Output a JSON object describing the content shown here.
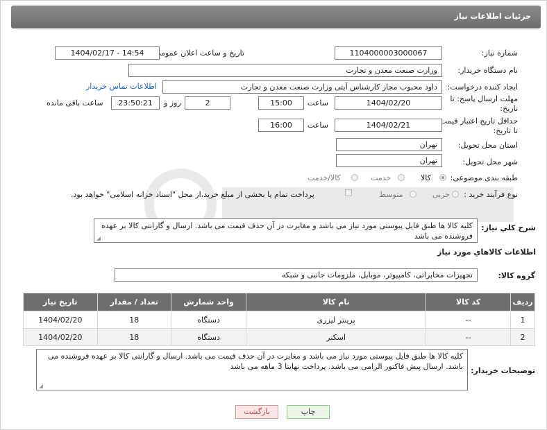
{
  "header": {
    "title": "جزئیات اطلاعات نیاز"
  },
  "form": {
    "need_number": {
      "label": "شماره نیاز:",
      "value": "1104000003000067"
    },
    "announce_datetime": {
      "label": "تاریخ و ساعت اعلان عمومی:",
      "value": "1404/02/17 - 14:54"
    },
    "buyer_org": {
      "label": "نام دستگاه خریدار:",
      "value": "وزارت صنعت معدن و تجارت"
    },
    "requester": {
      "label": "ایجاد کننده درخواست:",
      "value": "داود محبوب مجاز کارشناس آیتی وزارت صنعت معدن و تجارت",
      "contact_link": "اطلاعات تماس خریدار"
    },
    "reply_deadline": {
      "label_line1": "مهلت ارسال پاسخ: تا",
      "label_line2": "تاریخ:",
      "date": "1404/02/20",
      "time_label": "ساعت",
      "time": "15:00",
      "days": "2",
      "days_label": "روز و",
      "remaining": "23:50:21",
      "remaining_label": "ساعت باقی مانده"
    },
    "price_validity": {
      "label_line1": "حداقل تاریخ اعتبار قیمت:",
      "label_line2": "تا تاریخ:",
      "date": "1404/02/21",
      "time_label": "ساعت",
      "time": "16:00"
    },
    "delivery_province": {
      "label": "استان محل تحویل:",
      "value": "تهران"
    },
    "delivery_city": {
      "label": "شهر محل تحویل:",
      "value": "تهران"
    },
    "category": {
      "label": "طبقه بندی موضوعی:",
      "options": [
        "کالا",
        "خدمت",
        "کالا/خدمت"
      ],
      "selected": "کالا"
    },
    "purchase_type": {
      "label": "نوع فرآیند خرید :",
      "options": [
        "جزیی",
        "متوسط"
      ],
      "payment_text": "پرداخت تمام یا بخشی از مبلغ خرید،از محل \"اسناد خزانه اسلامی\" خواهد بود."
    },
    "general_desc": {
      "label": "شرح كلي نياز:",
      "value": "کلیه کالا ها طبق فایل پیوستی مورد نیاز می باشد و مغایرت در آن حذف قیمت می باشد. ارسال و گارانتی کالا بر عهده فروشنده می باشد"
    },
    "goods_info_title": "اطلاعات كالاهاي مورد نياز",
    "goods_group": {
      "label": "گروه کالا:",
      "value": "تجهیزات مخابراتی، کامپیوتر، موبایل، ملزومات جانبی و شبکه"
    },
    "buyer_notes": {
      "label": "توضیحات خریدار:",
      "value": "کلیه کالا ها طبق فایل پیوستی مورد نیاز می باشد و مغایرت در آن حذف قیمت می باشد. ارسال و گارانتی کالا بر عهده فروشنده می باشد. ارسال پیش فاکتور الزامی می باشد. پرداخت نهایتا 3 ماهه می باشد"
    }
  },
  "table": {
    "headers": [
      "ردیف",
      "کد کالا",
      "نام کالا",
      "واحد شمارش",
      "تعداد / مقدار",
      "تاریخ نیاز"
    ],
    "rows": [
      [
        "1",
        "--",
        "پرینتر لیزری",
        "دستگاه",
        "18",
        "1404/02/20"
      ],
      [
        "2",
        "--",
        "اسکنر",
        "دستگاه",
        "18",
        "1404/02/20"
      ]
    ]
  },
  "buttons": {
    "print": "چاپ",
    "back": "بازگشت"
  },
  "colors": {
    "header_bg": "#7a7a7a",
    "table_header_bg": "#6e6e6e",
    "link": "#1f5fbf",
    "back_btn": "#fde6e6",
    "print_btn": "#eaf7e6"
  }
}
